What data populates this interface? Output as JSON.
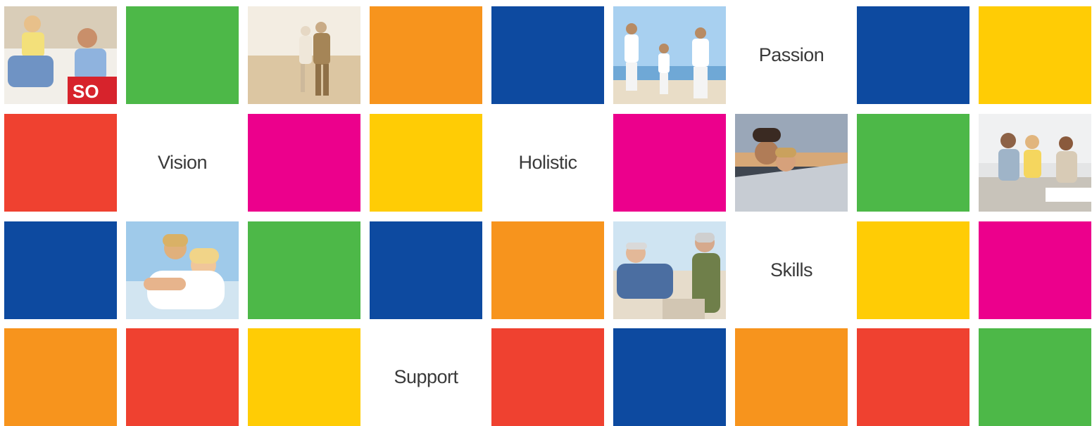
{
  "colors": {
    "green": "#4db848",
    "orange": "#f7941d",
    "blue": "#0d4aa0",
    "yellow": "#ffcc05",
    "red": "#ef4130",
    "magenta": "#ec008c",
    "white": "#ffffff"
  },
  "rows": [
    [
      {
        "kind": "photo",
        "name": "photo-couple-moving-box"
      },
      {
        "kind": "color",
        "color": "green"
      },
      {
        "kind": "photo",
        "name": "photo-elderly-couple-beach"
      },
      {
        "kind": "color",
        "color": "orange"
      },
      {
        "kind": "color",
        "color": "blue"
      },
      {
        "kind": "photo",
        "name": "photo-family-walking-beach"
      },
      {
        "kind": "word",
        "text": "Passion"
      },
      {
        "kind": "color",
        "color": "blue"
      },
      {
        "kind": "color",
        "color": "yellow"
      }
    ],
    [
      {
        "kind": "color",
        "color": "red"
      },
      {
        "kind": "word",
        "text": "Vision"
      },
      {
        "kind": "color",
        "color": "magenta"
      },
      {
        "kind": "color",
        "color": "yellow"
      },
      {
        "kind": "word",
        "text": "Holistic"
      },
      {
        "kind": "color",
        "color": "magenta"
      },
      {
        "kind": "photo",
        "name": "photo-couple-convertible-car"
      },
      {
        "kind": "color",
        "color": "green"
      },
      {
        "kind": "photo",
        "name": "photo-advisor-meeting-couple"
      }
    ],
    [
      {
        "kind": "color",
        "color": "blue"
      },
      {
        "kind": "photo",
        "name": "photo-mother-daughter-hug"
      },
      {
        "kind": "color",
        "color": "green"
      },
      {
        "kind": "color",
        "color": "blue"
      },
      {
        "kind": "color",
        "color": "orange"
      },
      {
        "kind": "photo",
        "name": "photo-seniors-relaxing-beach"
      },
      {
        "kind": "word",
        "text": "Skills"
      },
      {
        "kind": "color",
        "color": "yellow"
      },
      {
        "kind": "color",
        "color": "magenta"
      }
    ],
    [
      {
        "kind": "color",
        "color": "orange"
      },
      {
        "kind": "color",
        "color": "red"
      },
      {
        "kind": "color",
        "color": "yellow"
      },
      {
        "kind": "word",
        "text": "Support"
      },
      {
        "kind": "color",
        "color": "red"
      },
      {
        "kind": "color",
        "color": "blue"
      },
      {
        "kind": "color",
        "color": "orange"
      },
      {
        "kind": "color",
        "color": "red"
      },
      {
        "kind": "color",
        "color": "green"
      }
    ]
  ]
}
